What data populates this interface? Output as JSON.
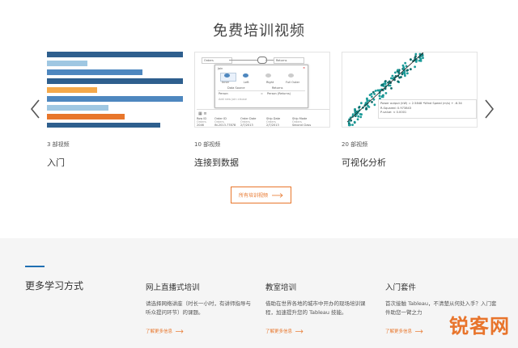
{
  "page": {
    "title": "免费培训视频"
  },
  "carousel": {
    "prev_icon": "chevron-left-icon",
    "next_icon": "chevron-right-icon",
    "cards": [
      {
        "count": "3 部视频",
        "title": "入门"
      },
      {
        "count": "10 部视频",
        "title": "连接到数据"
      },
      {
        "count": "20 部视频",
        "title": "可视化分析"
      }
    ],
    "join_thumb": {
      "left_table": "Orders",
      "right_table": "Returns",
      "join_label": "Join",
      "join_types": [
        "Inner",
        "Left",
        "Right",
        "Full Outer"
      ],
      "data_source": "Data Source",
      "returns": "Returns",
      "left_field": "Person",
      "right_field": "Person (Returns)",
      "add_clause": "Add new join clause",
      "grid_headers": [
        "Row ID",
        "Order ID",
        "Order Date",
        "Ship Date",
        "Ship Mode"
      ],
      "grid_sub": [
        "Orders",
        "Orders",
        "Orders",
        "Orders",
        "Orders"
      ],
      "grid_row": [
        "2046",
        "IN-2013-77878",
        "2/7/2013",
        "2/7/2013",
        "Second Class"
      ]
    },
    "scatter_thumb": {
      "line1": "Power output (kW) = 2.5848 *Wind Speed (m/s) + -6.34",
      "line2": "R-Squared: 0.973843",
      "line3": "P-value: < 0.0001"
    }
  },
  "all_videos_button": {
    "label": "所有培训视频",
    "icon": "arrow-right-icon"
  },
  "footer": {
    "heading": "更多学习方式",
    "columns": [
      {
        "title": "网上直播式培训",
        "desc": "请选择网络讲座（时长一小时，有讲师指导与听众提问环节）的课题。",
        "link": "了解更多信息"
      },
      {
        "title": "教室培训",
        "desc": "借助在世界各地的城市中开办的现场培训课程，加速提升您的 Tableau 技能。",
        "link": "了解更多信息"
      },
      {
        "title": "入门套件",
        "desc": "首次接触 Tableau，不清楚从何处入手？入门套件助您一臂之力",
        "link": "了解更多信息"
      }
    ]
  },
  "watermark": "锐客网",
  "colors": {
    "accent": "#e8762b",
    "blue_dark": "#2e5f8e",
    "blue_mid": "#4e87bf",
    "blue_light": "#9fc7e2",
    "teal": "#1a9a98"
  }
}
